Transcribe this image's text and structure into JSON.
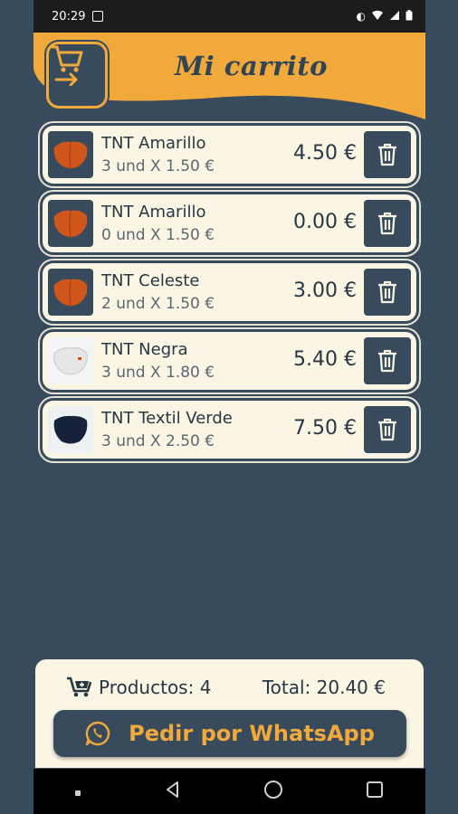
{
  "status_bar": {
    "time": "20:29"
  },
  "header": {
    "title": "Mi carrito",
    "cart_icon": "cart-arrow-icon"
  },
  "cart_items": [
    {
      "name": "TNT Amarillo",
      "detail": "3 und X 1.50 €",
      "price": "4.50 €",
      "mask_color": "#d0561c"
    },
    {
      "name": "TNT Amarillo",
      "detail": "0 und X 1.50 €",
      "price": "0.00 €",
      "mask_color": "#d0561c"
    },
    {
      "name": "TNT Celeste",
      "detail": "2 und X 1.50 €",
      "price": "3.00 €",
      "mask_color": "#d0561c"
    },
    {
      "name": "TNT Negra",
      "detail": "3 und X 1.80 €",
      "price": "5.40 €",
      "mask_color": "#ededed"
    },
    {
      "name": "TNT Textil Verde",
      "detail": "3 und X 2.50 €",
      "price": "7.50 €",
      "mask_color": "#16223a"
    }
  ],
  "summary": {
    "products_label": "Productos: 4",
    "total_label": "Total: 20.40 €"
  },
  "order_button": {
    "label": "Pedir por WhatsApp"
  },
  "colors": {
    "accent": "#f2a93b",
    "primary": "#374b5c",
    "card": "#fbf5e3"
  }
}
